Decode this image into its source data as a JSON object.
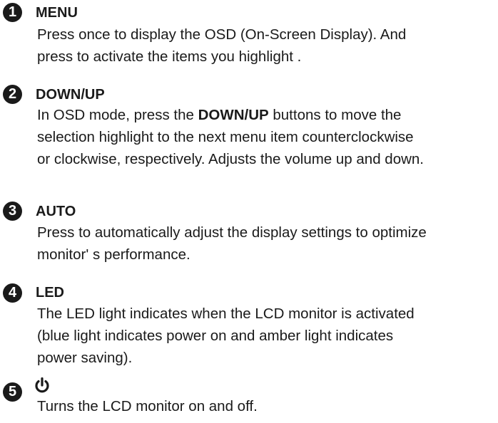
{
  "items": [
    {
      "number": "1",
      "title": "MENU",
      "lines": [
        "Press once to display the OSD (On-Screen Display). And",
        "press to activate the items you highlight ."
      ]
    },
    {
      "number": "2",
      "title": "DOWN/UP",
      "line1_pre": "In OSD mode, press the ",
      "line1_bold": "DOWN/UP",
      "line1_post": " buttons to move the",
      "lines": [
        "selection highlight to the next menu item counterclockwise",
        "or clockwise, respectively. Adjusts the volume up and down."
      ]
    },
    {
      "number": "3",
      "title": "AUTO",
      "lines": [
        "Press to automatically adjust the display settings to optimize",
        "monitor' s performance."
      ]
    },
    {
      "number": "4",
      "title": "LED",
      "lines": [
        "The LED light indicates when the LCD monitor is activated",
        "(blue light indicates power on and amber light indicates",
        "power saving)."
      ]
    },
    {
      "number": "5",
      "title_icon": "power-icon",
      "lines": [
        "Turns the LCD monitor on and off."
      ]
    }
  ]
}
